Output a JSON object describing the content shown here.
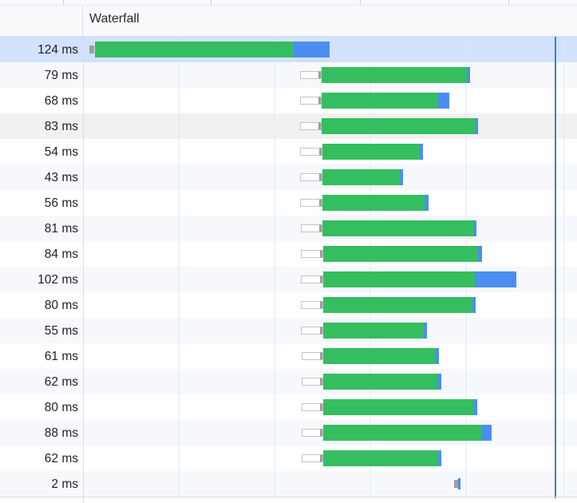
{
  "header": {
    "waterfall_label": "Waterfall"
  },
  "colors": {
    "queue": "#9e9e9e",
    "stalled_border": "#c4c4c4",
    "waiting": "#35be5f",
    "download": "#4a8ef2",
    "grid": "#dfe7f7"
  },
  "requests": [
    {
      "duration": "124 ms",
      "selected": true,
      "q": [
        112,
        118
      ],
      "s": null,
      "w": [
        119,
        368
      ],
      "d": [
        368,
        413
      ]
    },
    {
      "duration": "79 ms",
      "q": null,
      "s": [
        376,
        403
      ],
      "w": [
        403,
        585
      ],
      "d": [
        585,
        589
      ]
    },
    {
      "duration": "68 ms",
      "q": null,
      "s": [
        376,
        403
      ],
      "w": [
        403,
        548
      ],
      "d": [
        548,
        563
      ]
    },
    {
      "duration": "83 ms",
      "hover": true,
      "q": null,
      "s": [
        376,
        403
      ],
      "w": [
        403,
        595
      ],
      "d": [
        595,
        599
      ]
    },
    {
      "duration": "54 ms",
      "q": null,
      "s": [
        376,
        404
      ],
      "w": [
        404,
        526
      ],
      "d": [
        526,
        530
      ]
    },
    {
      "duration": "43 ms",
      "q": null,
      "s": [
        376,
        404
      ],
      "w": [
        404,
        501
      ],
      "d": [
        501,
        505
      ]
    },
    {
      "duration": "56 ms",
      "q": null,
      "s": [
        376,
        404
      ],
      "w": [
        404,
        532
      ],
      "d": [
        532,
        537
      ]
    },
    {
      "duration": "81 ms",
      "q": null,
      "s": [
        377,
        404
      ],
      "w": [
        404,
        593
      ],
      "d": [
        593,
        597
      ]
    },
    {
      "duration": "84 ms",
      "q": null,
      "s": [
        377,
        405
      ],
      "w": [
        405,
        599
      ],
      "d": [
        599,
        604
      ]
    },
    {
      "duration": "102 ms",
      "q": null,
      "s": [
        377,
        405
      ],
      "w": [
        405,
        595
      ],
      "d": [
        595,
        647
      ]
    },
    {
      "duration": "80 ms",
      "q": null,
      "s": [
        377,
        405
      ],
      "w": [
        405,
        592
      ],
      "d": [
        592,
        596
      ]
    },
    {
      "duration": "55 ms",
      "q": null,
      "s": [
        377,
        405
      ],
      "w": [
        405,
        531
      ],
      "d": [
        531,
        535
      ]
    },
    {
      "duration": "61 ms",
      "q": null,
      "s": [
        378,
        405
      ],
      "w": [
        405,
        546
      ],
      "d": [
        546,
        550
      ]
    },
    {
      "duration": "62 ms",
      "q": null,
      "s": [
        378,
        405
      ],
      "w": [
        405,
        548
      ],
      "d": [
        548,
        553
      ]
    },
    {
      "duration": "80 ms",
      "q": null,
      "s": [
        378,
        405
      ],
      "w": [
        405,
        594
      ],
      "d": [
        594,
        598
      ]
    },
    {
      "duration": "88 ms",
      "q": null,
      "s": [
        378,
        405
      ],
      "w": [
        405,
        604
      ],
      "d": [
        604,
        616
      ]
    },
    {
      "duration": "62 ms",
      "q": null,
      "s": [
        378,
        405
      ],
      "w": [
        405,
        549
      ],
      "d": [
        549,
        553
      ]
    },
    {
      "duration": "2 ms",
      "q": [
        569,
        574
      ],
      "s": null,
      "w": null,
      "d": [
        574,
        577
      ]
    }
  ]
}
